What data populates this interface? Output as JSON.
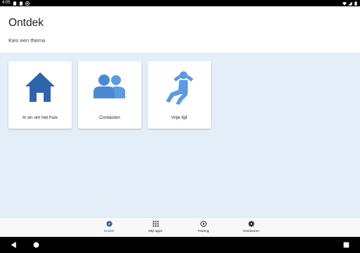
{
  "status_bar": {
    "time": "4:05",
    "left_icons": [
      "screenshot-icon",
      "sd-card-icon",
      "app-notification-icon"
    ],
    "right_icons": [
      "wifi-icon",
      "signal-icon",
      "battery-icon"
    ]
  },
  "header": {
    "title": "Ontdek",
    "subtitle": "Kies een thema"
  },
  "themes": [
    {
      "label": "In en om het huis",
      "icon": "house-icon"
    },
    {
      "label": "Contacten",
      "icon": "people-icon"
    },
    {
      "label": "Vrije tijd",
      "icon": "relaxing-person-icon"
    }
  ],
  "bottom_nav": {
    "items": [
      {
        "label": "Ontdek",
        "icon": "compass-icon",
        "active": true
      },
      {
        "label": "Mijn apps",
        "icon": "apps-grid-icon",
        "active": false
      },
      {
        "label": "Training",
        "icon": "play-circle-icon",
        "active": false
      },
      {
        "label": "Voorkeuren",
        "icon": "gear-icon",
        "active": false
      }
    ]
  },
  "system_nav": [
    "back-icon",
    "home-icon",
    "recents-icon"
  ],
  "colors": {
    "accent": "#2f65ad",
    "icon_blue_light": "#5b9be0",
    "content_background": "#e4eef8",
    "status_bar": "#000000"
  }
}
